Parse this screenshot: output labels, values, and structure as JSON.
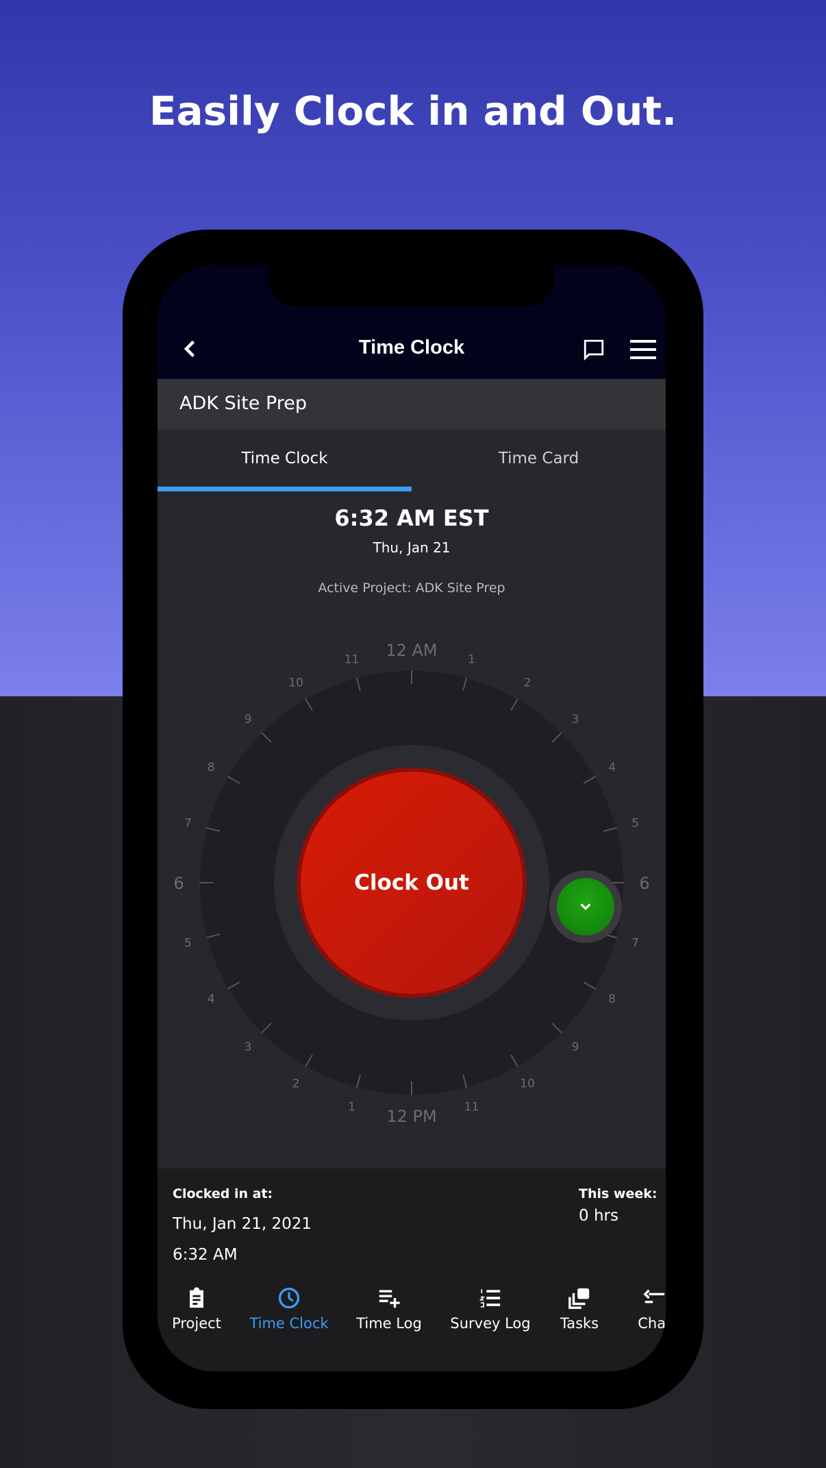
{
  "headline": "Easily Clock in and Out.",
  "appbar": {
    "title": "Time Clock",
    "back_icon": "chevron-left-icon",
    "chat_icon": "chat-bubble-icon",
    "menu_icon": "hamburger-menu-icon"
  },
  "project_name": "ADK Site Prep",
  "tabs": [
    {
      "label": "Time Clock",
      "active": true
    },
    {
      "label": "Time Card",
      "active": false
    }
  ],
  "current_time": "6:32 AM EST",
  "current_date": "Thu, Jan 21",
  "active_project": "Active Project: ADK Site Prep",
  "dial": {
    "labels": [
      "12 AM",
      "1",
      "2",
      "3",
      "4",
      "5",
      "6",
      "7",
      "8",
      "9",
      "10",
      "11",
      "12 PM",
      "1",
      "2",
      "3",
      "4",
      "5",
      "6",
      "7",
      "8",
      "9",
      "10",
      "11"
    ],
    "handle_time_hours": 6.53,
    "handle_icon": "chevron-down-icon"
  },
  "clock_out_label": "Clock Out",
  "colors": {
    "accent": "#3d9cf5",
    "clock_out": "#d01a08",
    "handle": "#169a0e",
    "header": "#02021a"
  },
  "info": {
    "clocked_in_label": "Clocked in at:",
    "clocked_in_date": "Thu, Jan 21, 2021",
    "clocked_in_time": "6:32 AM",
    "this_week_label": "This week:",
    "this_week_value": "0 hrs"
  },
  "nav": [
    {
      "label": "Project",
      "icon": "clipboard-icon"
    },
    {
      "label": "Time Clock",
      "icon": "clock-icon",
      "active": true
    },
    {
      "label": "Time Log",
      "icon": "playlist-add-icon"
    },
    {
      "label": "Survey Log",
      "icon": "numbered-list-icon"
    },
    {
      "label": "Tasks",
      "icon": "layers-icon"
    },
    {
      "label": "Char",
      "icon": "swap-icon"
    }
  ]
}
